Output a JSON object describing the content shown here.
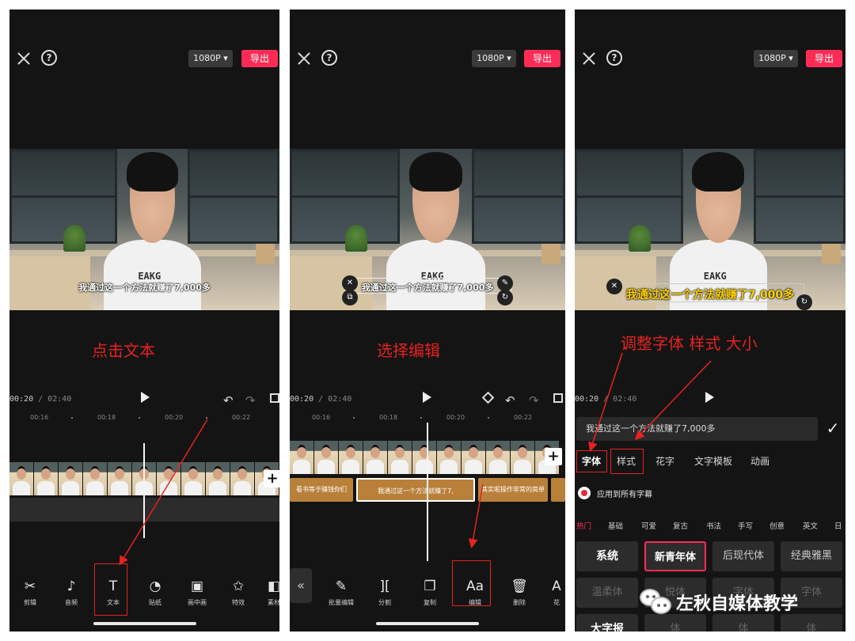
{
  "topbar": {
    "resolution": "1080P ▾",
    "export_label": "导出",
    "help_glyph": "?"
  },
  "video": {
    "subtitle": "我通过这一个方法就赚了7,000多",
    "shirt_logo": "EAKG"
  },
  "annotations": {
    "p1": "点击文本",
    "p2": "选择编辑",
    "p3": "调整字体 样式 大小"
  },
  "timeline": {
    "current": "00:20",
    "separator": " / ",
    "total": "02:40",
    "ruler": [
      "00:16",
      "00:18",
      "00:20",
      "00:22"
    ]
  },
  "text_clips": {
    "left": "看书等于赚钱你们",
    "selected": "我通过这一个方法就赚了7,",
    "right": "其实呢操作非常的简单"
  },
  "toolbar1": [
    {
      "icon": "✂",
      "label": "剪辑"
    },
    {
      "icon": "♪",
      "label": "音频"
    },
    {
      "icon": "T",
      "label": "文本"
    },
    {
      "icon": "◔",
      "label": "贴纸"
    },
    {
      "icon": "▣",
      "label": "画中画"
    },
    {
      "icon": "✩",
      "label": "特效"
    },
    {
      "icon": "◧",
      "label": "素材"
    }
  ],
  "toolbar2": {
    "back": "«",
    "items": [
      {
        "icon": "✎",
        "label": "批量编辑"
      },
      {
        "icon": "][",
        "label": "分割"
      },
      {
        "icon": "❐",
        "label": "复制"
      },
      {
        "icon": "Aa",
        "label": "编辑"
      },
      {
        "icon": "🗑",
        "label": "删除"
      },
      {
        "icon": "A",
        "label": "花"
      }
    ]
  },
  "editor": {
    "input_value": "我通过这一个方法就赚了7,000多",
    "confirm": "✓",
    "tabs": [
      "字体",
      "样式",
      "花字",
      "文字模板",
      "动画"
    ],
    "apply_all": "应用到所有字幕",
    "categories": [
      "热门",
      "基础",
      "可爱",
      "复古",
      "书法",
      "手写",
      "创意",
      "英文",
      "日"
    ],
    "fonts_row1": [
      "系统",
      "新青年体",
      "后现代体",
      "经典雅黑"
    ],
    "fonts_row2": [
      "温柔体",
      "悦体",
      "字体",
      "字体"
    ],
    "fonts_row3": [
      "大字报",
      "体",
      "体",
      "体"
    ]
  },
  "watermark": "左秋自媒体教学",
  "colors": {
    "accent": "#fe2c55",
    "annotation": "#e52222",
    "panel_bg": "#141414"
  }
}
